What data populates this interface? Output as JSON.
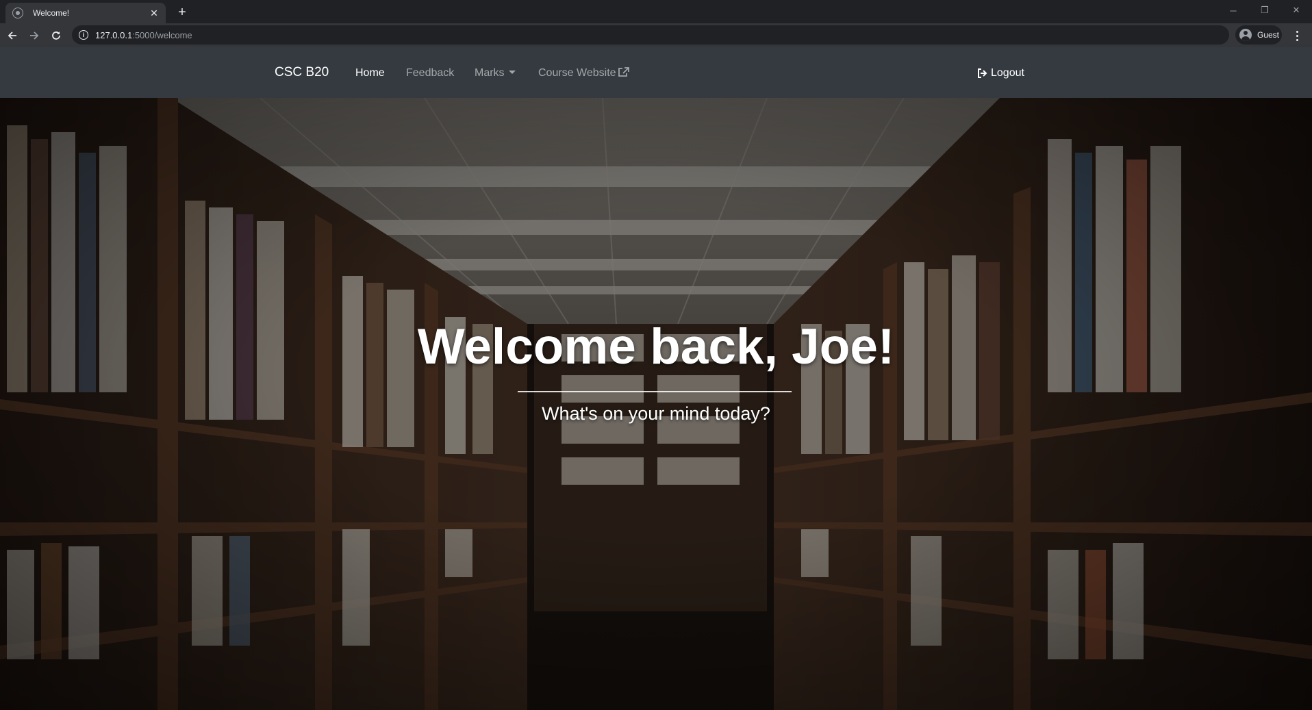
{
  "browser": {
    "tab_title": "Welcome!",
    "new_tab_symbol": "+",
    "url_host": "127.0.0.1",
    "url_path": ":5000/welcome",
    "profile_label": "Guest"
  },
  "navbar": {
    "brand": "CSC B20",
    "links": [
      {
        "label": "Home",
        "active": true
      },
      {
        "label": "Feedback",
        "active": false
      },
      {
        "label": "Marks",
        "active": false,
        "dropdown": true
      },
      {
        "label": "Course Website",
        "active": false,
        "external": true
      }
    ],
    "logout_label": "Logout",
    "background": "#343a40"
  },
  "hero": {
    "headline": "Welcome back, Joe!",
    "subline": "What's on your mind today?"
  }
}
